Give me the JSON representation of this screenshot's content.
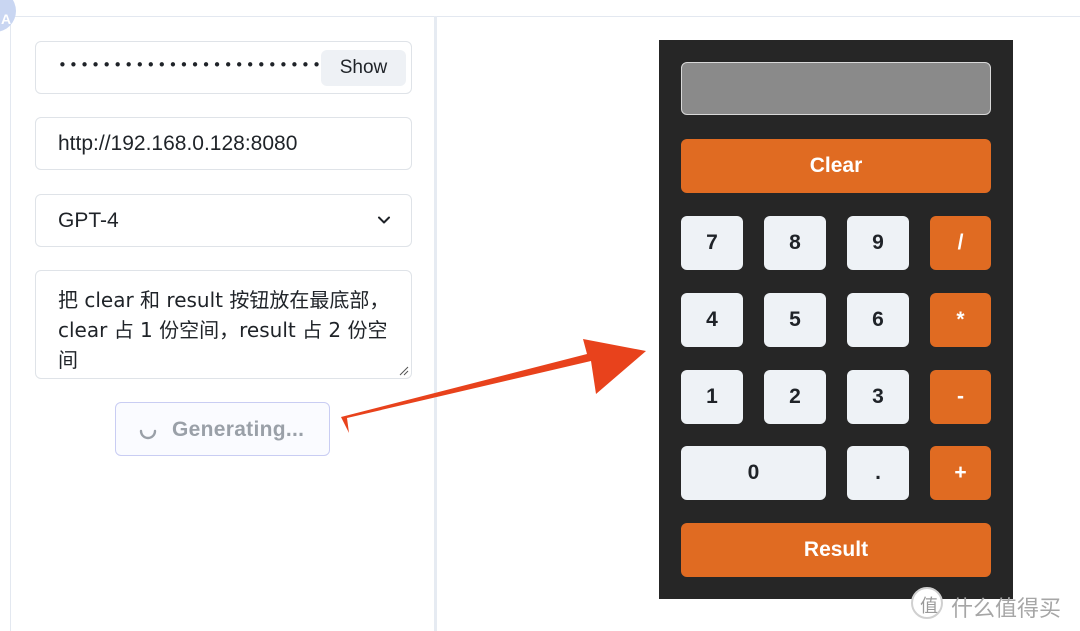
{
  "settings": {
    "api_key_masked": "••••••••••••••••••••••••",
    "show_label": "Show",
    "server_url": "http://192.168.0.128:8080",
    "model": "GPT-4",
    "prompt": "把 clear 和  result 按钮放在最底部，clear 占 1 份空间，result 占 2 份空间",
    "generate_label": "Generating..."
  },
  "calculator": {
    "display_value": "",
    "clear_label": "Clear",
    "result_label": "Result",
    "keys": {
      "k7": "7",
      "k8": "8",
      "k9": "9",
      "div": "/",
      "k4": "4",
      "k5": "5",
      "k6": "6",
      "mul": "*",
      "k1": "1",
      "k2": "2",
      "k3": "3",
      "sub": "-",
      "k0": "0",
      "dot": ".",
      "add": "+"
    }
  },
  "colors": {
    "accent_orange": "#e06b22",
    "calc_background": "#262626",
    "display_gray": "#8a8a8a",
    "arrow_red": "#e8421c",
    "key_light": "#eef2f6"
  },
  "watermark": {
    "logo_char": "值",
    "text": "什么值得买"
  }
}
